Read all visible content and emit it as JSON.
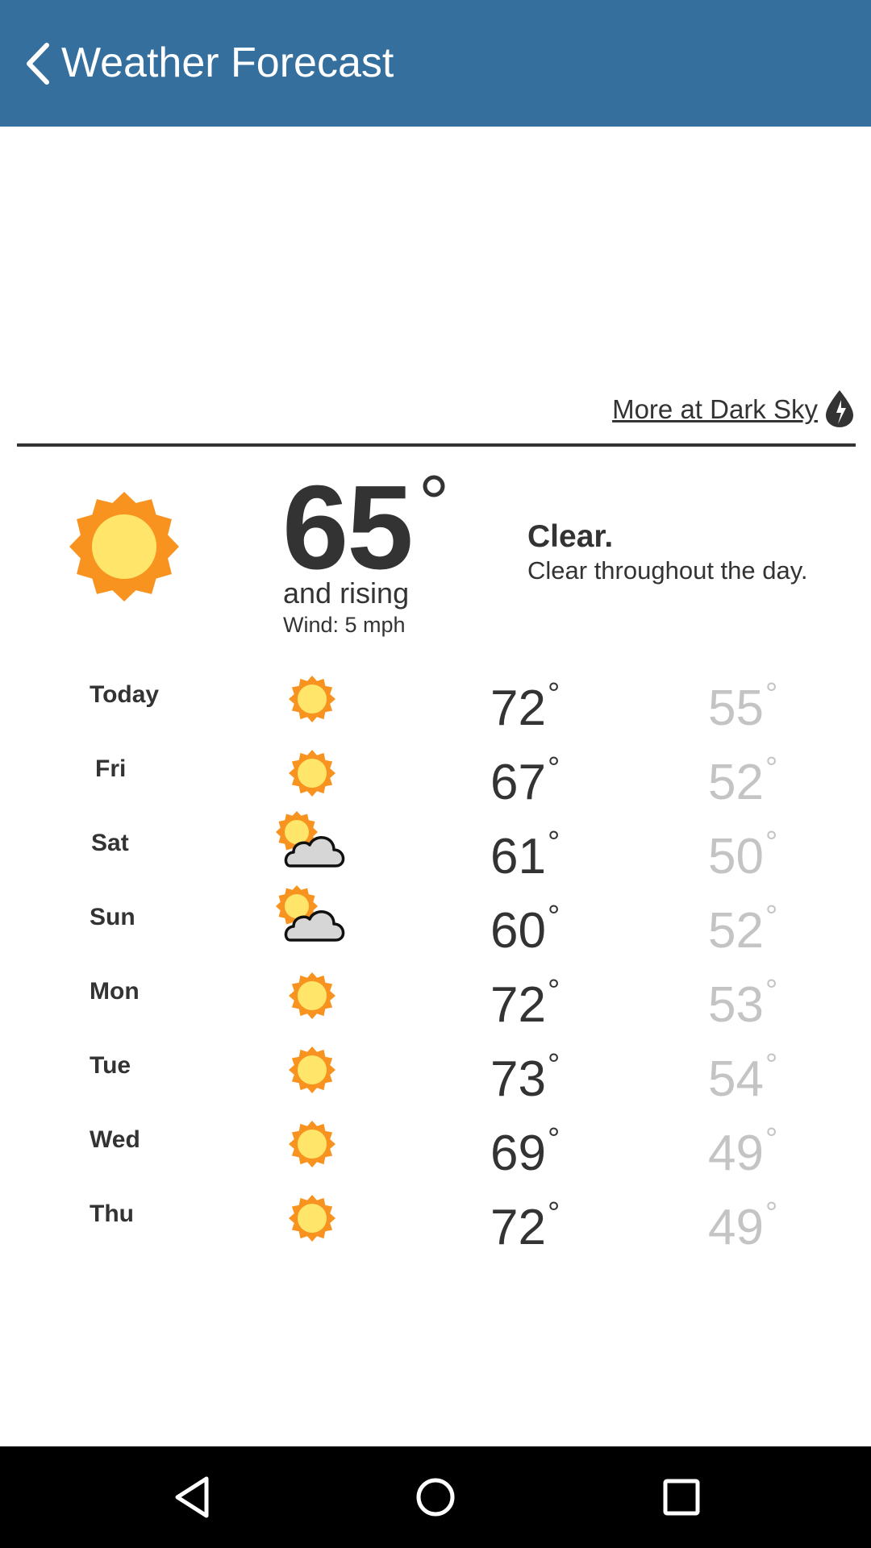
{
  "header": {
    "title": "Weather Forecast",
    "back_icon": "chevron-left-icon"
  },
  "attribution": {
    "link_text": "More at Dark Sky",
    "logo_icon": "dark-sky-logo-icon"
  },
  "current": {
    "icon": "sun-icon",
    "temperature": "65",
    "degree_symbol": "°",
    "trend": "and rising",
    "wind": "Wind: 5 mph",
    "summary": "Clear.",
    "detail": "Clear throughout the day."
  },
  "forecast": [
    {
      "day": "Today",
      "icon": "sun-icon",
      "high": "72",
      "low": "55"
    },
    {
      "day": "Fri",
      "icon": "sun-icon",
      "high": "67",
      "low": "52"
    },
    {
      "day": "Sat",
      "icon": "partly-cloudy-icon",
      "high": "61",
      "low": "50"
    },
    {
      "day": "Sun",
      "icon": "partly-cloudy-icon",
      "high": "60",
      "low": "52"
    },
    {
      "day": "Mon",
      "icon": "sun-icon",
      "high": "72",
      "low": "53"
    },
    {
      "day": "Tue",
      "icon": "sun-icon",
      "high": "73",
      "low": "54"
    },
    {
      "day": "Wed",
      "icon": "sun-icon",
      "high": "69",
      "low": "49"
    },
    {
      "day": "Thu",
      "icon": "sun-icon",
      "high": "72",
      "low": "49"
    }
  ],
  "degree_symbol": "°",
  "colors": {
    "appbar": "#346f9e",
    "sun_outer": "#f7931e",
    "sun_inner": "#ffe66b",
    "cloud_fill": "#d6d6d6",
    "low_temp": "#c4c4c4",
    "text": "#333333"
  },
  "navigation": {
    "back_icon": "nav-back-icon",
    "home_icon": "nav-home-icon",
    "recents_icon": "nav-recents-icon"
  }
}
